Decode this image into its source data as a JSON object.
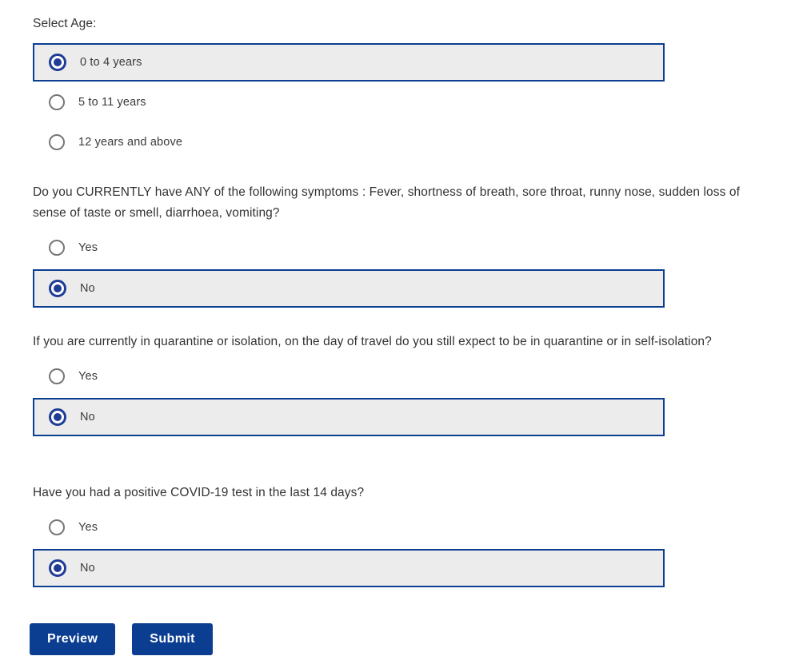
{
  "form": {
    "sections": [
      {
        "id": "age",
        "label": "Select Age:",
        "options": [
          {
            "label": "0 to 4 years",
            "selected": true
          },
          {
            "label": "5 to 11 years",
            "selected": false
          },
          {
            "label": "12 years and above",
            "selected": false
          }
        ]
      },
      {
        "id": "symptoms",
        "label": "Do you CURRENTLY have ANY of the following symptoms : Fever, shortness of breath, sore throat, runny nose, sudden loss of sense of taste or smell, diarrhoea, vomiting?",
        "options": [
          {
            "label": "Yes",
            "selected": false
          },
          {
            "label": "No",
            "selected": true
          }
        ]
      },
      {
        "id": "quarantine",
        "label": "If you are currently in quarantine or isolation, on the day of travel do you still expect to be in quarantine or in self-isolation?",
        "options": [
          {
            "label": "Yes",
            "selected": false
          },
          {
            "label": "No",
            "selected": true
          }
        ]
      },
      {
        "id": "covid-test",
        "label": "Have you had a positive COVID-19 test in the last 14 days?",
        "options": [
          {
            "label": "Yes",
            "selected": false
          },
          {
            "label": "No",
            "selected": true
          }
        ]
      }
    ],
    "buttons": {
      "preview_label": "Preview",
      "submit_label": "Submit"
    },
    "colors": {
      "accent_blue": "#0b3d91",
      "radio_blue": "#1f3c96",
      "selected_row_background": "#ececec",
      "radio_outline_gray": "#767676",
      "text": "#333333",
      "button_text": "#ffffff"
    }
  }
}
